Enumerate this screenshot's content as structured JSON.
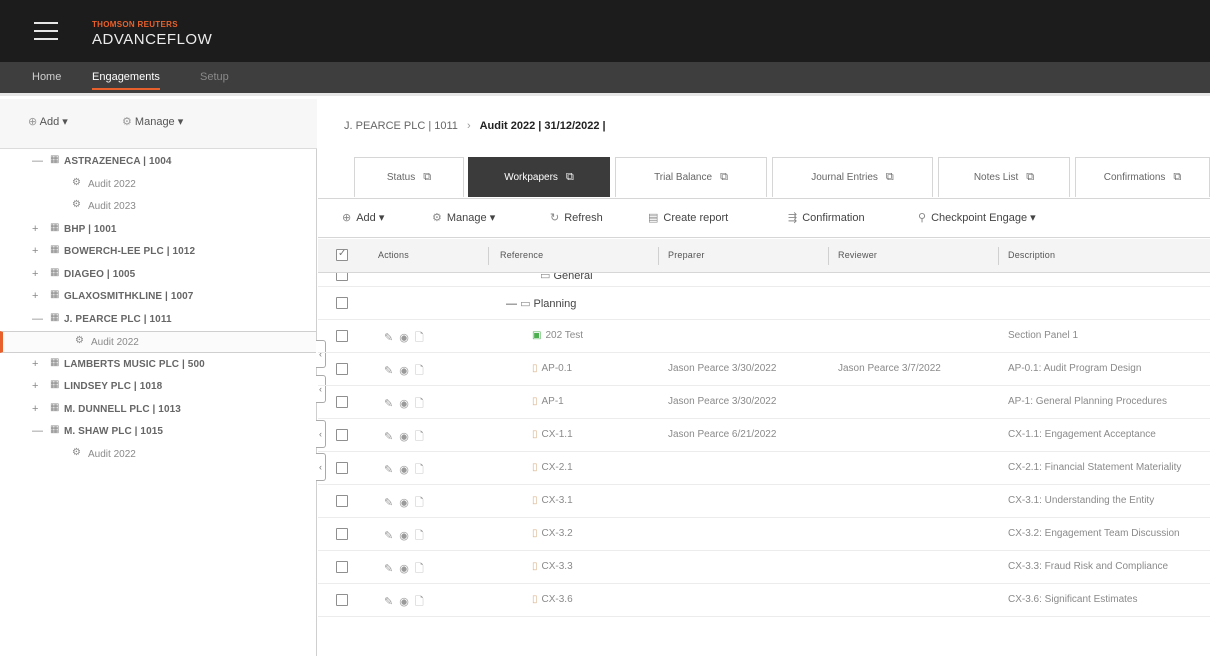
{
  "header": {
    "brand_small": "THOMSON REUTERS",
    "brand_big": "ADVANCEFLOW"
  },
  "nav": {
    "home": "Home",
    "engagements": "Engagements",
    "setup": "Setup"
  },
  "sidebar": {
    "add": "Add",
    "manage": "Manage",
    "tree": [
      {
        "type": "client",
        "label": "ASTRAZENECA | 1004",
        "expanded": true
      },
      {
        "type": "audit",
        "label": "Audit 2022"
      },
      {
        "type": "audit",
        "label": "Audit 2023"
      },
      {
        "type": "client",
        "label": "BHP | 1001",
        "expanded": false
      },
      {
        "type": "client",
        "label": "BOWERCH-LEE PLC | 1012",
        "expanded": false
      },
      {
        "type": "client",
        "label": "DIAGEO | 1005",
        "expanded": false
      },
      {
        "type": "client",
        "label": "GLAXOSMITHKLINE | 1007",
        "expanded": false
      },
      {
        "type": "client",
        "label": "J. PEARCE PLC | 1011",
        "expanded": true
      },
      {
        "type": "audit",
        "label": "Audit 2022",
        "selected": true
      },
      {
        "type": "client",
        "label": "LAMBERTS MUSIC PLC | 500",
        "expanded": false
      },
      {
        "type": "client",
        "label": "LINDSEY PLC | 1018",
        "expanded": false
      },
      {
        "type": "client",
        "label": "M. DUNNELL PLC | 1013",
        "expanded": false
      },
      {
        "type": "client",
        "label": "M. SHAW PLC | 1015",
        "expanded": true
      },
      {
        "type": "audit",
        "label": "Audit 2022"
      }
    ]
  },
  "breadcrumb": {
    "client": "J. PEARCE PLC | 1011",
    "current": "Audit 2022 | 31/12/2022 |"
  },
  "tabs": [
    "Status",
    "Workpapers",
    "Trial Balance",
    "Journal Entries",
    "Notes List",
    "Confirmations"
  ],
  "active_tab": "Workpapers",
  "toolbar": {
    "add": "Add",
    "manage": "Manage",
    "refresh": "Refresh",
    "create_report": "Create report",
    "confirmation": "Confirmation",
    "checkpoint": "Checkpoint Engage"
  },
  "grid": {
    "columns": [
      "Actions",
      "Reference",
      "Preparer",
      "Reviewer",
      "Description"
    ],
    "rows": [
      {
        "kind": "folder",
        "reference": "General"
      },
      {
        "kind": "folder",
        "reference": "Planning",
        "expanded": true
      },
      {
        "kind": "doc",
        "green": true,
        "reference": "202 Test",
        "preparer": "",
        "reviewer": "",
        "description": "Section Panel 1"
      },
      {
        "kind": "doc",
        "reference": "AP-0.1",
        "preparer": "Jason Pearce 3/30/2022",
        "reviewer": "Jason Pearce 3/7/2022",
        "description": "AP-0.1: Audit Program Design"
      },
      {
        "kind": "doc",
        "reference": "AP-1",
        "preparer": "Jason Pearce 3/30/2022",
        "reviewer": "",
        "description": "AP-1: General Planning Procedures"
      },
      {
        "kind": "doc",
        "reference": "CX-1.1",
        "preparer": "Jason Pearce 6/21/2022",
        "reviewer": "",
        "description": "CX-1.1: Engagement Acceptance"
      },
      {
        "kind": "doc",
        "reference": "CX-2.1",
        "preparer": "",
        "reviewer": "",
        "description": "CX-2.1: Financial Statement Materiality"
      },
      {
        "kind": "doc",
        "reference": "CX-3.1",
        "preparer": "",
        "reviewer": "",
        "description": "CX-3.1: Understanding the Entity"
      },
      {
        "kind": "doc",
        "reference": "CX-3.2",
        "preparer": "",
        "reviewer": "",
        "description": "CX-3.2: Engagement Team Discussion"
      },
      {
        "kind": "doc",
        "reference": "CX-3.3",
        "preparer": "",
        "reviewer": "",
        "description": "CX-3.3: Fraud Risk and Compliance"
      },
      {
        "kind": "doc",
        "reference": "CX-3.6",
        "preparer": "",
        "reviewer": "",
        "description": "CX-3.6: Significant Estimates"
      }
    ]
  }
}
